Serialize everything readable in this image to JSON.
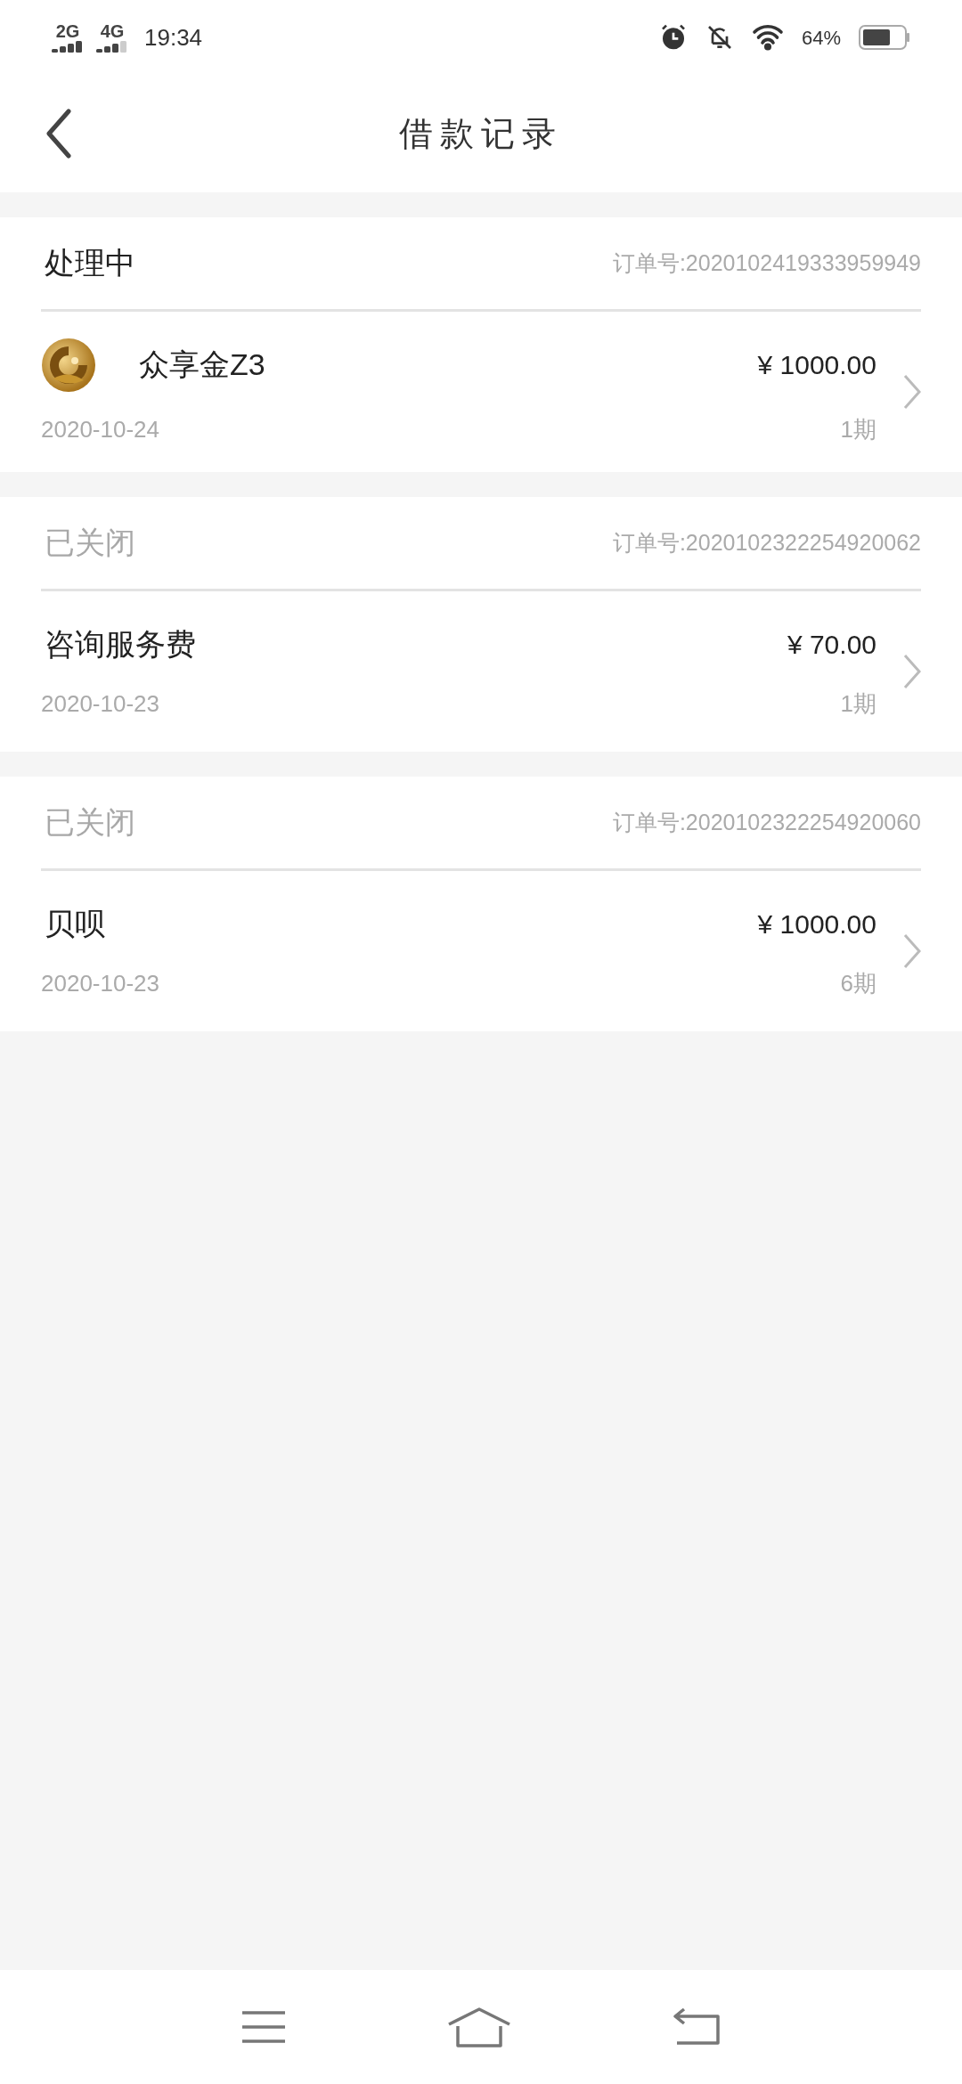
{
  "status_bar": {
    "network_1": "2G",
    "network_2": "4G",
    "time": "19:34",
    "battery": "64%"
  },
  "header": {
    "title": "借款记录"
  },
  "records": [
    {
      "status": "处理中",
      "closed": false,
      "order_no": "订单号:2020102419333959949",
      "logo": true,
      "name": "众享金Z3",
      "amount": "¥ 1000.00",
      "date": "2020-10-24",
      "periods": "1期"
    },
    {
      "status": "已关闭",
      "closed": true,
      "order_no": "订单号:2020102322254920062",
      "logo": false,
      "name": "咨询服务费",
      "amount": "¥ 70.00",
      "date": "2020-10-23",
      "periods": "1期"
    },
    {
      "status": "已关闭",
      "closed": true,
      "order_no": "订单号:2020102322254920060",
      "logo": false,
      "name": "贝呗",
      "amount": "¥ 1000.00",
      "date": "2020-10-23",
      "periods": "6期"
    }
  ]
}
